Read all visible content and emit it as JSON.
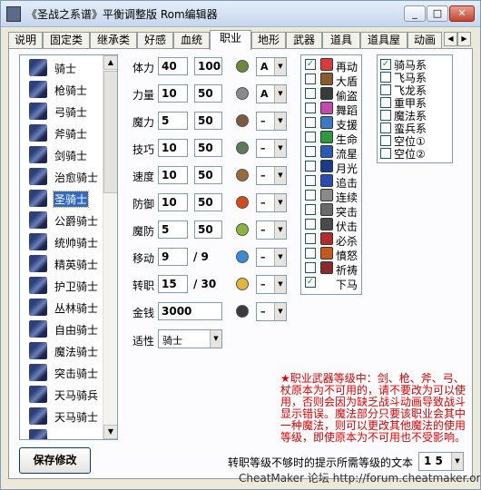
{
  "window": {
    "title": "《圣战之系谱》平衡调整版 Rom编辑器",
    "min": "_",
    "max": "□",
    "close": "✕"
  },
  "tabs": [
    "说明",
    "固定类",
    "继承类",
    "好感",
    "血统",
    "职业",
    "地形",
    "武器",
    "道具",
    "道具屋",
    "动画"
  ],
  "active_tab": "职业",
  "classes": [
    "骑士",
    "枪骑士",
    "弓骑士",
    "斧骑士",
    "剑骑士",
    "治愈骑士",
    "圣骑士",
    "公爵骑士",
    "统帅骑士",
    "精英骑士",
    "护卫骑士",
    "丛林骑士",
    "自由骑士",
    "魔法骑士",
    "突击骑士",
    "天马骑兵",
    "天马骑士"
  ],
  "selected_class": "圣骑士",
  "stats": [
    {
      "label": "体力",
      "base": "40",
      "max": "100",
      "grade": "A"
    },
    {
      "label": "力量",
      "base": "10",
      "max": "50",
      "grade": "A"
    },
    {
      "label": "魔力",
      "base": "5",
      "max": "50",
      "grade": "–"
    },
    {
      "label": "技巧",
      "base": "10",
      "max": "50",
      "grade": "–"
    },
    {
      "label": "速度",
      "base": "10",
      "max": "50",
      "grade": "–"
    },
    {
      "label": "防御",
      "base": "10",
      "max": "50",
      "grade": "–"
    },
    {
      "label": "魔防",
      "base": "5",
      "max": "50",
      "grade": "–"
    }
  ],
  "move": {
    "label": "移动",
    "value": "9",
    "max": "/ 9",
    "grade": "–"
  },
  "promote": {
    "label": "转职",
    "value": "15",
    "max": "/ 30",
    "grade": "–"
  },
  "money": {
    "label": "金钱",
    "value": "3000",
    "grade": "–"
  },
  "aptitude": {
    "label": "适性",
    "value": "骑士"
  },
  "skills": [
    {
      "label": "再动",
      "checked": true,
      "color": "#d93a3a"
    },
    {
      "label": "大盾",
      "checked": false,
      "color": "#8a5a2a"
    },
    {
      "label": "偷盗",
      "checked": false,
      "color": "#3a3a3a"
    },
    {
      "label": "舞蹈",
      "checked": false,
      "color": "#c44ab0"
    },
    {
      "label": "支援",
      "checked": false,
      "color": "#3a7ac4"
    },
    {
      "label": "生命",
      "checked": false,
      "color": "#2a9a3a"
    },
    {
      "label": "流星",
      "checked": false,
      "color": "#2a5ab4"
    },
    {
      "label": "月光",
      "checked": false,
      "color": "#1a3a8a"
    },
    {
      "label": "追击",
      "checked": false,
      "color": "#2a4ab4"
    },
    {
      "label": "连续",
      "checked": false,
      "color": "#8a8a8a"
    },
    {
      "label": "突击",
      "checked": false,
      "color": "#6a6a6a"
    },
    {
      "label": "伏击",
      "checked": false,
      "color": "#4a4a4a"
    },
    {
      "label": "必杀",
      "checked": false,
      "color": "#b42a2a"
    },
    {
      "label": "憤怒",
      "checked": false,
      "color": "#c45a1a"
    },
    {
      "label": "祈祷",
      "checked": false,
      "color": "#8a2a2a"
    },
    {
      "label": "下马",
      "checked": true,
      "color": "#ffffff"
    }
  ],
  "unit_types": [
    {
      "label": "骑马系",
      "checked": true
    },
    {
      "label": "飞马系",
      "checked": false
    },
    {
      "label": "飞龙系",
      "checked": false
    },
    {
      "label": "重甲系",
      "checked": false
    },
    {
      "label": "魔法系",
      "checked": false
    },
    {
      "label": "蛮兵系",
      "checked": false
    },
    {
      "label": "空位①",
      "checked": false
    },
    {
      "label": "空位②",
      "checked": false
    }
  ],
  "note": "★职业武器等级中：剑、枪、斧、弓、杖原本为不可用的，请不要改为可以使用，否则会因为缺乏战斗动画导致战斗显示错误。魔法部分只要该职业会其中一种魔法，则可以更改其他魔法的使用等级，即使原本为不可用也不受影响。",
  "save_label": "保存修改",
  "hint": {
    "label": "转职等级不够时的提示所需等级的文本",
    "value": "1 5"
  },
  "footer": "CheatMaker 论坛 http://forum.cheatmaker.org/"
}
